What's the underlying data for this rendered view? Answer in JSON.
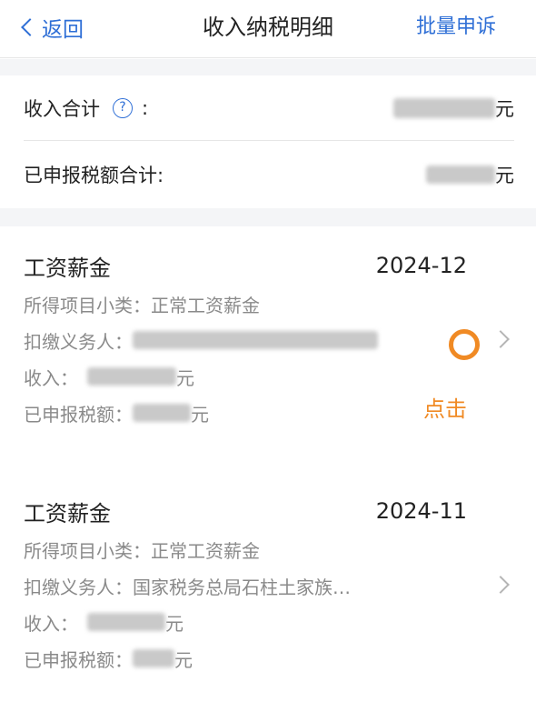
{
  "nav": {
    "back_label": "返回",
    "title": "收入纳税明细",
    "action_label": "批量申诉"
  },
  "summary": {
    "income_total_label": "收入合计",
    "income_total_colon": ":",
    "help_icon_glyph": "?",
    "income_unit": "元",
    "tax_total_label": "已申报税额合计:",
    "tax_unit": "元"
  },
  "records": [
    {
      "category": "工资薪金",
      "period": "2024-12",
      "subcategory_label": "所得项目小类：",
      "subcategory_value": "正常工资薪金",
      "withholder_label": "扣缴义务人：",
      "withholder_value": "",
      "income_label": "收入：",
      "income_unit": "元",
      "tax_label": "已申报税额：",
      "tax_unit": "元"
    },
    {
      "category": "工资薪金",
      "period": "2024-11",
      "subcategory_label": "所得项目小类：",
      "subcategory_value": "正常工资薪金",
      "withholder_label": "扣缴义务人：",
      "withholder_value": "国家税务总局石柱土家族…",
      "income_label": "收入：",
      "income_unit": "元",
      "tax_label": "已申报税额：",
      "tax_unit": "元"
    }
  ],
  "annotation": {
    "tap_label": "点击",
    "color": "#f08a24"
  },
  "colors": {
    "accent": "#2f6fd6",
    "muted_text": "#8a8a8a",
    "section_bg": "#f4f5f7"
  }
}
